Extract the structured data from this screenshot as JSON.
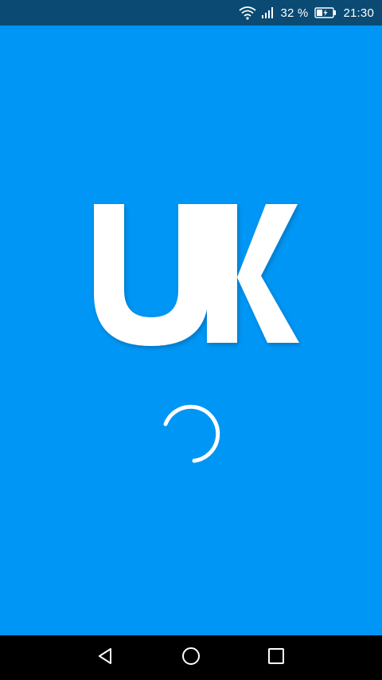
{
  "status_bar": {
    "battery_percent": "32 %",
    "time": "21:30",
    "icons": [
      "wifi-icon",
      "signal-icon",
      "battery-charging-icon"
    ]
  },
  "splash": {
    "logo_text": "UK",
    "loading": true
  },
  "nav_bar": {
    "icons": [
      "back-triangle-icon",
      "home-circle-icon",
      "recents-square-icon"
    ]
  },
  "colors": {
    "background": "#0096F5",
    "status_bar": "#0A4A73",
    "nav_bar": "#000000",
    "foreground": "#FFFFFF"
  }
}
